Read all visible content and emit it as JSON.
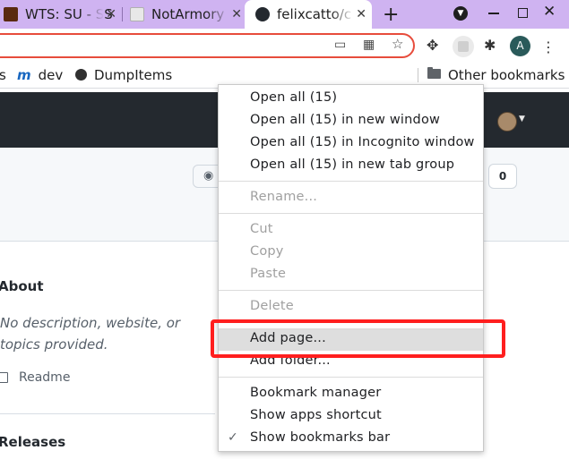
{
  "tabs": [
    {
      "title": "WTS: SU - SS",
      "favicon_color": "#5a2a10"
    },
    {
      "title": "NotArmory",
      "favicon_color": "#e8e8e8"
    },
    {
      "title": "felixcatto/c",
      "favicon": "github-icon"
    }
  ],
  "tab_close_glyph": "✕",
  "new_tab_glyph": "+",
  "window_close_glyph": "✕",
  "profile_initial": "A",
  "bookmarks": [
    {
      "label": "s"
    },
    {
      "label": "dev",
      "icon": "m-icon"
    },
    {
      "label": "DumpItems",
      "icon": "globe-icon"
    }
  ],
  "other_bookmarks": "Other bookmarks",
  "page": {
    "watch_count": "0",
    "about_heading": "About",
    "about_description": "No description, website, or topics provided.",
    "readme_label": "Readme",
    "releases_heading": "Releases"
  },
  "context_menu": {
    "group1": [
      "Open all (15)",
      "Open all (15) in new window",
      "Open all (15) in Incognito window",
      "Open all (15) in new tab group"
    ],
    "group2": [
      "Rename..."
    ],
    "group3": [
      "Cut",
      "Copy",
      "Paste"
    ],
    "group4": [
      "Delete"
    ],
    "group5": [
      "Add page...",
      "Add folder..."
    ],
    "group6": [
      "Bookmark manager",
      "Show apps shortcut",
      "Show bookmarks bar"
    ],
    "highlighted_item": "Add page...",
    "checked_item": "Show bookmarks bar"
  },
  "colors": {
    "tabstrip": "#cfb3f1",
    "github_header": "#24292f",
    "annotation_red": "#ff1f1f",
    "omnibox_focus": "#e74c3c"
  }
}
